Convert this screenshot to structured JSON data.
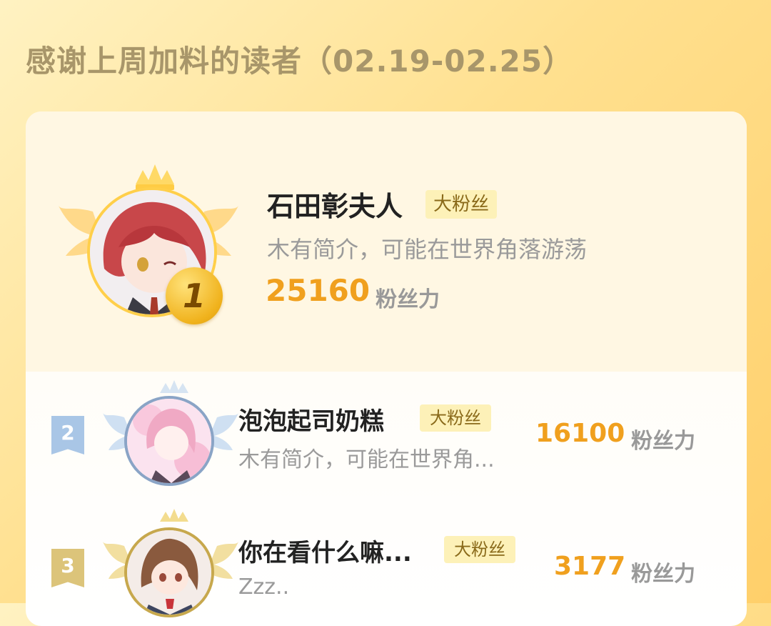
{
  "page_title": "感谢上周加料的读者（02.19-02.25）",
  "tag_label": "大粉丝",
  "score_unit": "粉丝力",
  "colors": {
    "gold": "#f0a01e",
    "silver_badge": "#9fc0e3",
    "bronze_badge": "#dcc47a",
    "tag_bg": "#fdf1b8"
  },
  "readers": [
    {
      "rank": "1",
      "name": "石田彰夫人",
      "bio": "木有简介，可能在世界角落游荡",
      "score": "25160",
      "avatar_icon": "anime-girl-red-hair-avatar"
    },
    {
      "rank": "2",
      "name": "泡泡起司奶糕",
      "bio": "木有简介，可能在世界角...",
      "score": "16100",
      "avatar_icon": "anime-girl-pink-hair-avatar"
    },
    {
      "rank": "3",
      "name": "你在看什么嘛...",
      "bio": "Zzz..",
      "score": "3177",
      "avatar_icon": "anime-girl-brown-hair-avatar"
    }
  ]
}
